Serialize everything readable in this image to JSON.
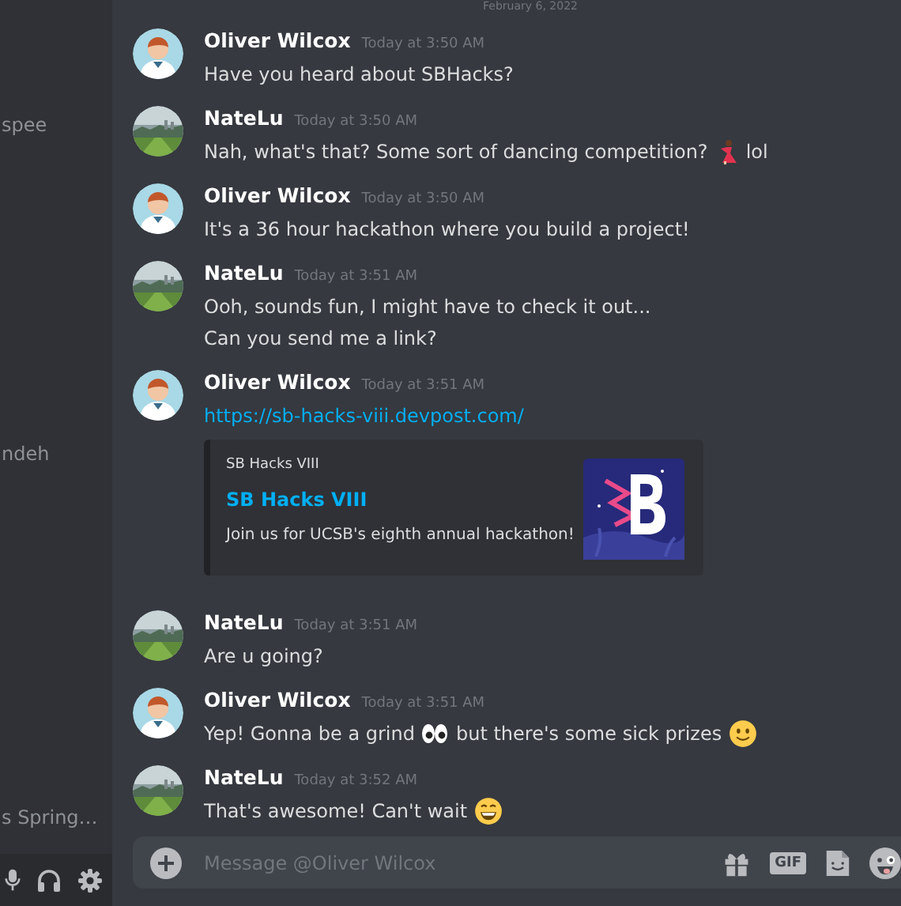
{
  "sidebar": {
    "items": [
      {
        "label": "spee"
      },
      {
        "label": "ndeh"
      },
      {
        "label": "s Spring…"
      }
    ]
  },
  "divider": {
    "date": "February 6, 2022"
  },
  "messages": [
    {
      "author": "Oliver Wilcox",
      "avatar": {
        "kind": "figure"
      },
      "time": "Today at 3:50 AM",
      "lines": [
        [
          {
            "kind": "text",
            "text": "Have you heard about SBHacks?"
          }
        ]
      ]
    },
    {
      "author": "NateLu",
      "avatar": {
        "kind": "landscape"
      },
      "time": "Today at 3:50 AM",
      "lines": [
        [
          {
            "kind": "text",
            "text": "Nah, what's that? Some sort of dancing competition?"
          },
          {
            "kind": "dancer"
          },
          {
            "kind": "text",
            "text": "lol"
          }
        ]
      ]
    },
    {
      "author": "Oliver Wilcox",
      "avatar": {
        "kind": "figure"
      },
      "time": "Today at 3:50 AM",
      "lines": [
        [
          {
            "kind": "text",
            "text": "It's a 36 hour hackathon where you build a project!"
          }
        ]
      ]
    },
    {
      "author": "NateLu",
      "avatar": {
        "kind": "landscape"
      },
      "time": "Today at 3:51 AM",
      "lines": [
        [
          {
            "kind": "text",
            "text": "Ooh, sounds fun, I might have to check it out..."
          }
        ],
        [
          {
            "kind": "text",
            "text": "Can you send me a link?"
          }
        ]
      ]
    },
    {
      "author": "Oliver Wilcox",
      "avatar": {
        "kind": "figure"
      },
      "time": "Today at 3:51 AM",
      "lines": [
        [
          {
            "kind": "link",
            "text": "https://sb-hacks-viii.devpost.com/"
          }
        ]
      ],
      "embed": {
        "provider": "SB Hacks VIII",
        "title": "SB Hacks VIII",
        "description": "Join us for UCSB's eighth annual hackathon!"
      }
    },
    {
      "author": "NateLu",
      "avatar": {
        "kind": "landscape"
      },
      "time": "Today at 3:51 AM",
      "lines": [
        [
          {
            "kind": "text",
            "text": "Are u going?"
          }
        ]
      ]
    },
    {
      "author": "Oliver Wilcox",
      "avatar": {
        "kind": "figure"
      },
      "time": "Today at 3:51 AM",
      "lines": [
        [
          {
            "kind": "text",
            "text": "Yep! Gonna be a grind"
          },
          {
            "kind": "eyes"
          },
          {
            "kind": "text",
            "text": "but there's some sick prizes"
          },
          {
            "kind": "smile"
          }
        ]
      ]
    },
    {
      "author": "NateLu",
      "avatar": {
        "kind": "landscape"
      },
      "time": "Today at 3:52 AM",
      "lines": [
        [
          {
            "kind": "text",
            "text": "That's awesome! Can't wait"
          },
          {
            "kind": "grin"
          }
        ]
      ]
    }
  ],
  "composer": {
    "placeholder": "Message @Oliver Wilcox",
    "gif_label": "GIF"
  }
}
